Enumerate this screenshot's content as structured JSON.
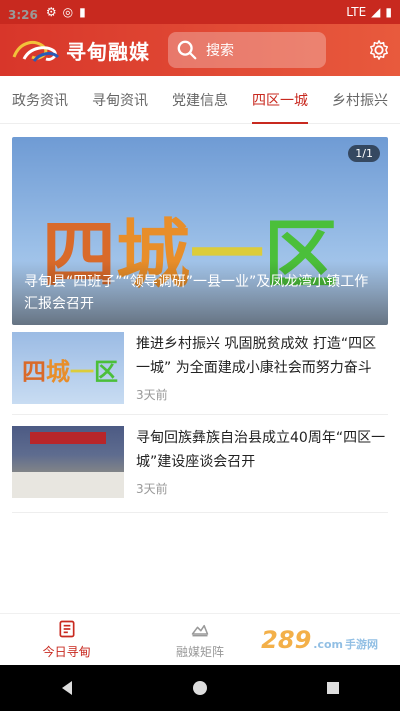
{
  "status": {
    "time": "3:26",
    "network": "LTE"
  },
  "header": {
    "app_name": "寻甸融媒",
    "search_placeholder": "搜索"
  },
  "tabs": [
    {
      "label": "政务资讯"
    },
    {
      "label": "寻甸资讯"
    },
    {
      "label": "党建信息"
    },
    {
      "label": "四区一城"
    },
    {
      "label": "乡村振兴"
    }
  ],
  "active_tab": "四区一城",
  "hero": {
    "badge": "1/1",
    "image_text": [
      "四",
      "城",
      "一",
      "区"
    ],
    "title": "寻甸县“四班子”“领导调研”一县一业”及凤龙湾小镇工作汇报会召开"
  },
  "articles": [
    {
      "title": "推进乡村振兴 巩固脱贫成效 打造“四区一城” 为全面建成小康社会而努力奋斗",
      "time": "3天前",
      "thumb_text": [
        "四",
        "城",
        "一",
        "区"
      ]
    },
    {
      "title": "寻甸回族彝族自治县成立40周年“四区一城”建设座谈会召开",
      "time": "3天前"
    }
  ],
  "bottom_nav": [
    {
      "label": "今日寻甸"
    },
    {
      "label": "融媒矩阵"
    }
  ],
  "watermark": {
    "text": "289",
    "suffix": ".com",
    "sub": "手游网"
  },
  "colors": {
    "brand": "#c8291f",
    "header_gradient_end": "#e85a3d"
  }
}
